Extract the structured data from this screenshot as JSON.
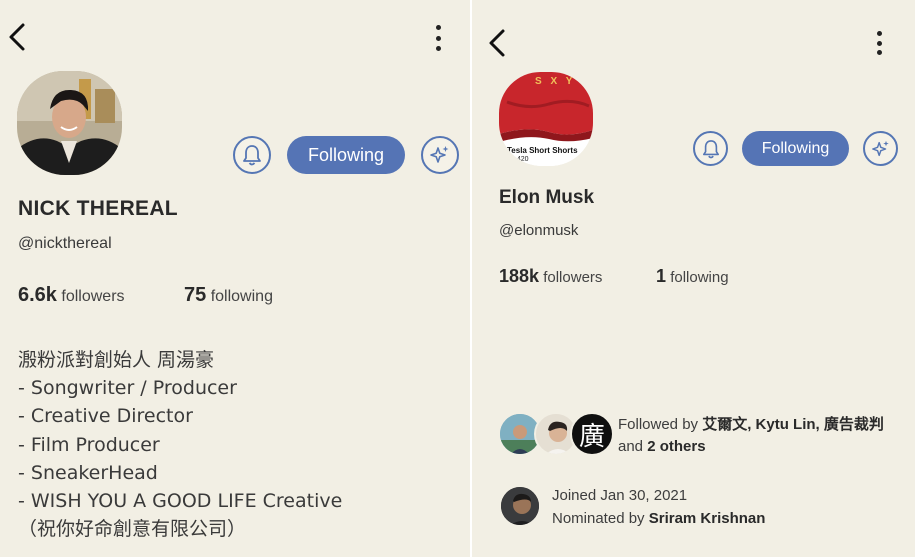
{
  "left_profile": {
    "name": "NICK THEREAL",
    "handle": "@nickthereal",
    "follow_label": "Following",
    "followers_count": "6.6k",
    "followers_label": "followers",
    "following_count": "75",
    "following_label": "following",
    "bio_lines": [
      "溵粉派對創始人 周湯豪",
      "- Songwriter / Producer",
      "- Creative Director",
      "- Film Producer",
      "- SneakerHead",
      "- WISH YOU A GOOD LIFE Creative",
      "（祝你好命創意有限公司）"
    ]
  },
  "right_profile": {
    "name": "Elon Musk",
    "handle": "@elonmusk",
    "follow_label": "Following",
    "followers_count": "188k",
    "followers_label": "followers",
    "following_count": "1",
    "following_label": "following",
    "avatar_caption": "Tesla Short Shorts",
    "avatar_price": "$ 420",
    "avatar_shirt_text": "S X Y",
    "followed_by_prefix": "Followed by",
    "followed_by_names": "艾爾文, Kytu Lin, 廣告裁判",
    "followed_by_and": "and",
    "followed_by_others": "2 others",
    "mutual_avatar_glyph": "廣",
    "joined": "Joined Jan 30, 2021",
    "nominated_prefix": "Nominated by",
    "nominated_by": "Sriram Krishnan"
  },
  "colors": {
    "background": "#f2efe4",
    "accent": "#5574b5",
    "text": "#2a2a2a"
  },
  "icons": [
    "back-arrow-icon",
    "more-vertical-icon",
    "bell-icon",
    "sparkles-icon"
  ]
}
